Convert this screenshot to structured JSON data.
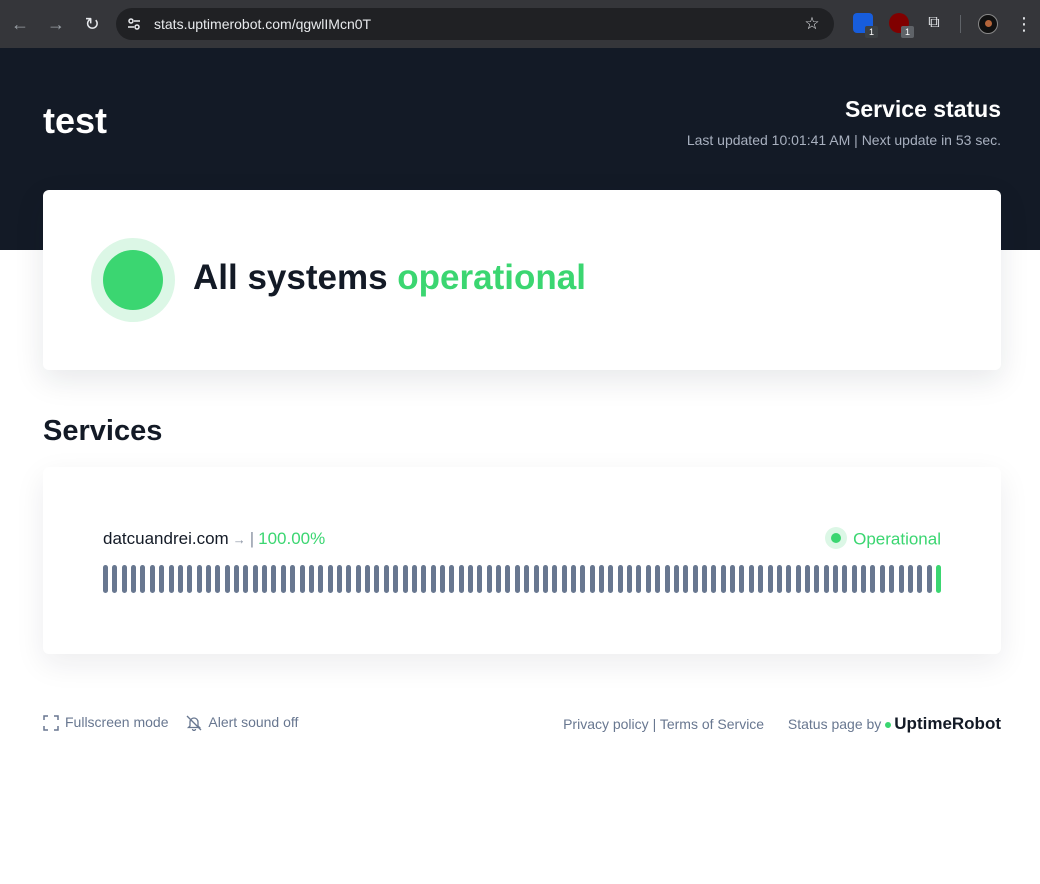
{
  "browser": {
    "url": "stats.uptimerobot.com/qgwlIMcn0T",
    "extensions": [
      {
        "name": "bitwarden-icon",
        "badge": "1"
      },
      {
        "name": "ublock-icon",
        "badge": "1"
      }
    ]
  },
  "header": {
    "title": "test",
    "status_label": "Service status",
    "last_updated": "Last updated 10:01:41 AM | Next update in 53 sec."
  },
  "overall": {
    "prefix": "All systems",
    "state": "operational",
    "color": "#3bd671"
  },
  "services": {
    "title": "Services",
    "items": [
      {
        "name": "datcuandrei.com",
        "arrow": "→",
        "separator": "|",
        "uptime": "100.00%",
        "status": "Operational",
        "bar_count": 90,
        "bar_colors": {
          "no_data": "#687790",
          "up": "#3bd671"
        }
      }
    ]
  },
  "footer": {
    "fullscreen": "Fullscreen mode",
    "alert_sound": "Alert sound off",
    "privacy": "Privacy policy",
    "separator": "|",
    "terms": "Terms of Service",
    "powered_by": "Status page by",
    "brand": "UptimeRobot"
  }
}
